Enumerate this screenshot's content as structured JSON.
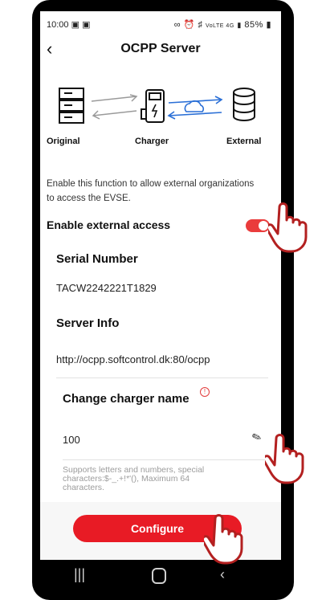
{
  "status_bar": {
    "time": "10:00",
    "icons_left": [
      "gallery-icon",
      "notification-icon"
    ],
    "indicators": "VoLTE 4G",
    "battery": "85%"
  },
  "header": {
    "title": "OCPP Server",
    "back_icon": "chevron-left-icon"
  },
  "diagram": {
    "labels": [
      "Original",
      "Charger",
      "External"
    ]
  },
  "description": "Enable this function to allow external organizations to access the EVSE.",
  "external_access": {
    "label": "Enable external access",
    "enabled": true,
    "accent": "#ea3c3c"
  },
  "serial": {
    "title": "Serial Number",
    "value": "TACW2242221T1829"
  },
  "server": {
    "title": "Server Info",
    "value": "http://ocpp.softcontrol.dk:80/ocpp"
  },
  "charger_name": {
    "title": "Change charger name",
    "info_icon": "info-icon",
    "value": "100",
    "edit_icon": "pencil-icon",
    "hint": "Supports letters and numbers, special characters:$-_.+!*'(), Maximum 64 characters."
  },
  "footer": {
    "configure_label": "Configure",
    "accent": "#e81b25"
  },
  "nav": {
    "icons": [
      "recent-apps-icon",
      "home-icon",
      "back-icon"
    ]
  }
}
